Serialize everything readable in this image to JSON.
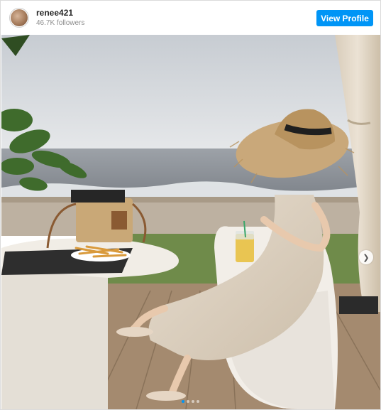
{
  "profile": {
    "username": "renee421",
    "followers": "46.7K followers",
    "view_profile_label": "View Profile"
  },
  "post": {
    "image_count": 4,
    "active_index": 0
  },
  "colors": {
    "accent": "#0095f6",
    "sky": "#d9dde1",
    "sea": "#8b9097",
    "deck": "#a48a6f",
    "dress": "#ddd2c1",
    "chair": "#f2eee8",
    "hat": "#c9a87a"
  },
  "icons": {
    "next": "chevron-right-icon"
  }
}
